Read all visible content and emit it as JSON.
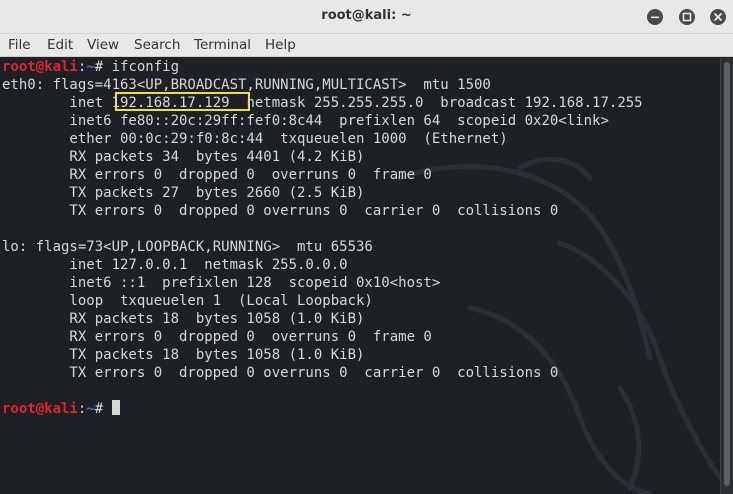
{
  "window": {
    "title": "root@kali: ~",
    "controls": {
      "minimize_icon": "minimize-icon",
      "maximize_icon": "maximize-icon",
      "close_icon": "close-icon"
    }
  },
  "menubar": {
    "items": [
      "File",
      "Edit",
      "View",
      "Search",
      "Terminal",
      "Help"
    ]
  },
  "colors": {
    "background": "#1d2125",
    "text": "#d5d8da",
    "prompt_user": "#e2232d",
    "prompt_path": "#3a6fd9",
    "highlight": "#f3e12b"
  },
  "terminal": {
    "prompt1": {
      "user": "root@kali",
      "colon": ":",
      "path": "~",
      "symbol": "# ",
      "command": "ifconfig"
    },
    "eth0": [
      "eth0: flags=4163<UP,BROADCAST,RUNNING,MULTICAST>  mtu 1500",
      {
        "pre": "        inet ",
        "ip": "192.168.17.129",
        "post": "  netmask 255.255.255.0  broadcast 192.168.17.255"
      },
      "        inet6 fe80::20c:29ff:fef0:8c44  prefixlen 64  scopeid 0x20<link>",
      "        ether 00:0c:29:f0:8c:44  txqueuelen 1000  (Ethernet)",
      "        RX packets 34  bytes 4401 (4.2 KiB)",
      "        RX errors 0  dropped 0  overruns 0  frame 0",
      "        TX packets 27  bytes 2660 (2.5 KiB)",
      "        TX errors 0  dropped 0 overruns 0  carrier 0  collisions 0"
    ],
    "lo": [
      "lo: flags=73<UP,LOOPBACK,RUNNING>  mtu 65536",
      "        inet 127.0.0.1  netmask 255.0.0.0",
      "        inet6 ::1  prefixlen 128  scopeid 0x10<host>",
      "        loop  txqueuelen 1  (Local Loopback)",
      "        RX packets 18  bytes 1058 (1.0 KiB)",
      "        RX errors 0  dropped 0  overruns 0  frame 0",
      "        TX packets 18  bytes 1058 (1.0 KiB)",
      "        TX errors 0  dropped 0 overruns 0  carrier 0  collisions 0"
    ],
    "prompt2": {
      "user": "root@kali",
      "colon": ":",
      "path": "~",
      "symbol": "# "
    }
  }
}
